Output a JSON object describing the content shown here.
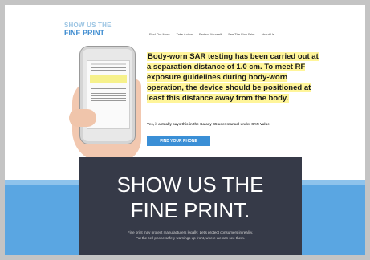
{
  "logo": {
    "line1": "SHOW US THE",
    "line2": "FINE PRINT"
  },
  "nav": [
    "Find Out More",
    "Take Action",
    "Protect Yourself",
    "See The Fine Print",
    "About Us"
  ],
  "hero": {
    "headline_part1": "Body-worn SAR",
    "headline_part2": " testing has been carried out at a separation distance of 1.0 cm. To meet RF exposure guidelines during body-worn operation, the device should be positioned at least this distance away from the body.",
    "subtext": "Yes, it actually says this in the Galaxy S5 user manual under SAR Value.",
    "cta_label": "FIND YOUR PHONE"
  },
  "panel": {
    "title_line1": "SHOW US THE",
    "title_line2": "FINE PRINT.",
    "body_line1": "Fine print may protect manufacturers legally. Let's protect consumers in reality.",
    "body_line2": "Put the cell phone safety warnings up front, where we can see them."
  },
  "colors": {
    "accent": "#3a8fd6",
    "highlight": "#fff59a",
    "panel": "#363a48"
  }
}
